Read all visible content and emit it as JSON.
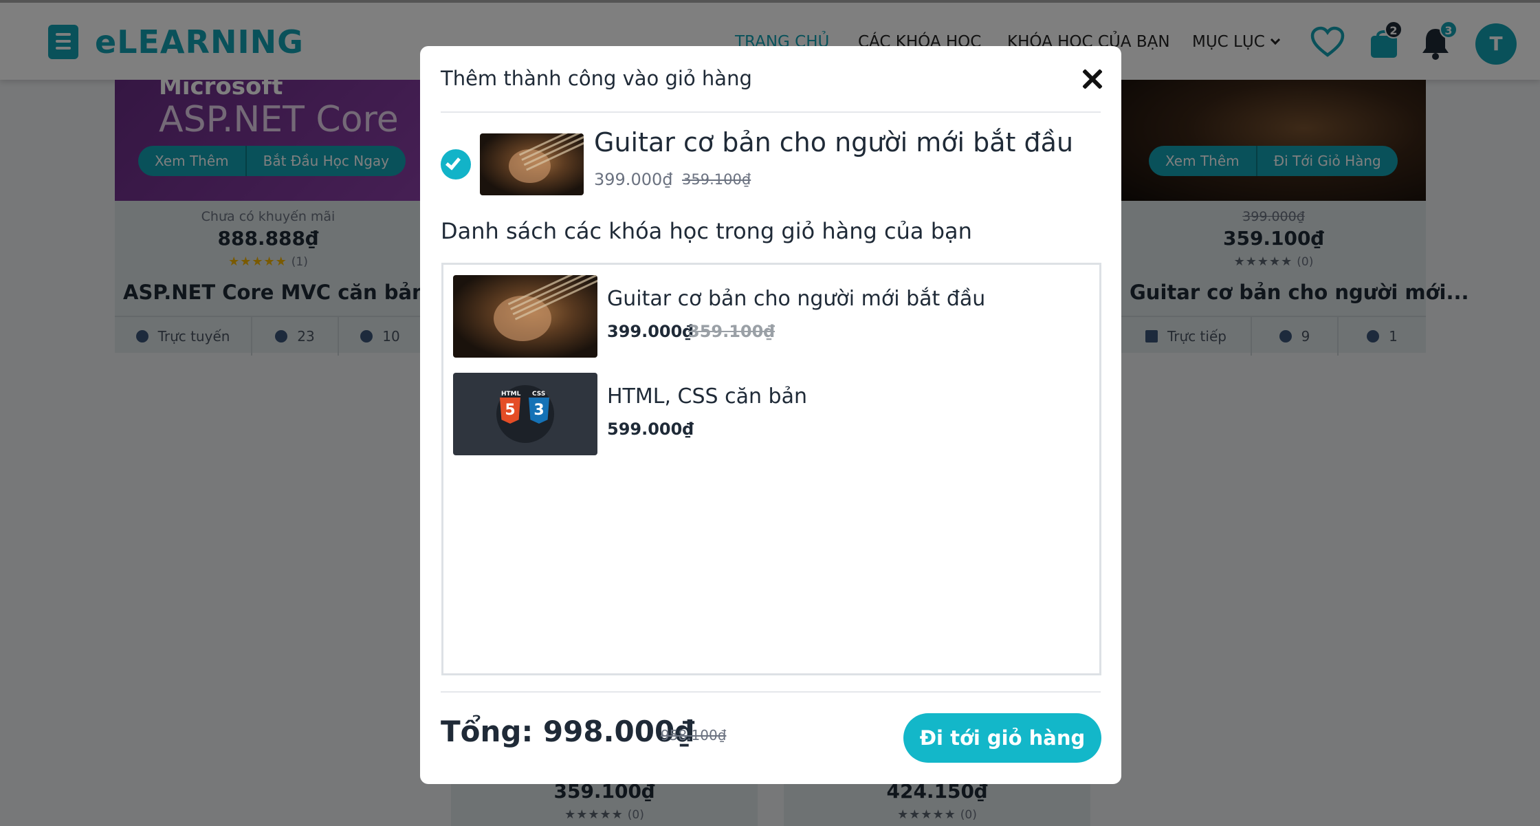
{
  "brand": {
    "name": "eLEARNING"
  },
  "nav": {
    "home": "TRANG CHỦ",
    "courses": "CÁC KHÓA HỌC",
    "my_courses": "KHÓA HỌC CỦA BẠN",
    "menu": "MỤC LỤC",
    "cart_count": "2",
    "notification_count": "3",
    "avatar_initial": "T"
  },
  "colors": {
    "accent": "#12a3b4",
    "button": "#13b7c9",
    "badge": "#1f2a37"
  },
  "background_cards": [
    {
      "image_title": "ASP.NET Core",
      "logo_text": "Microsoft",
      "btn_more": "Xem Thêm",
      "btn_action": "Bắt Đầu Học Ngay",
      "promo": "Chưa có khuyến mãi",
      "price": "888.888₫",
      "rating_stars": "★★★★★",
      "rating_count": "(1)",
      "title": "ASP.NET Core MVC căn bản",
      "mode": "Trực tuyến",
      "lessons": "23",
      "students": "10"
    },
    {
      "btn_more": "Xem Thêm",
      "btn_action": "Đi Tới Giỏ Hàng",
      "old_price": "399.000₫",
      "price": "359.100₫",
      "rating_stars": "★★★★★",
      "rating_count": "(0)",
      "title": "Guitar cơ bản cho người mới...",
      "mode": "Trực tiếp",
      "lessons": "9",
      "students": "1"
    },
    {
      "price": "359.100₫",
      "rating_stars": "★★★★★",
      "rating_count": "(0)"
    },
    {
      "price": "424.150₫",
      "rating_stars": "★★★★★",
      "rating_count": "(0)"
    }
  ],
  "modal": {
    "title": "Thêm thành công vào giỏ hàng",
    "added": {
      "name": "Guitar cơ bản cho người mới bắt đầu",
      "price": "399.000₫",
      "old_price": "359.100₫"
    },
    "list_heading": "Danh sách các khóa học trong giỏ hàng của bạn",
    "items": [
      {
        "name": "Guitar cơ bản cho người mới bắt đầu",
        "price": "399.000₫",
        "old_price": "359.100₫"
      },
      {
        "name": "HTML, CSS căn bản",
        "price": "599.000₫",
        "html_label": "HTML",
        "css_label": "CSS"
      }
    ],
    "total_label": "Tổng: 998.000₫",
    "total_old": "958.100₫",
    "go_to_cart": "Đi tới giỏ hàng"
  }
}
